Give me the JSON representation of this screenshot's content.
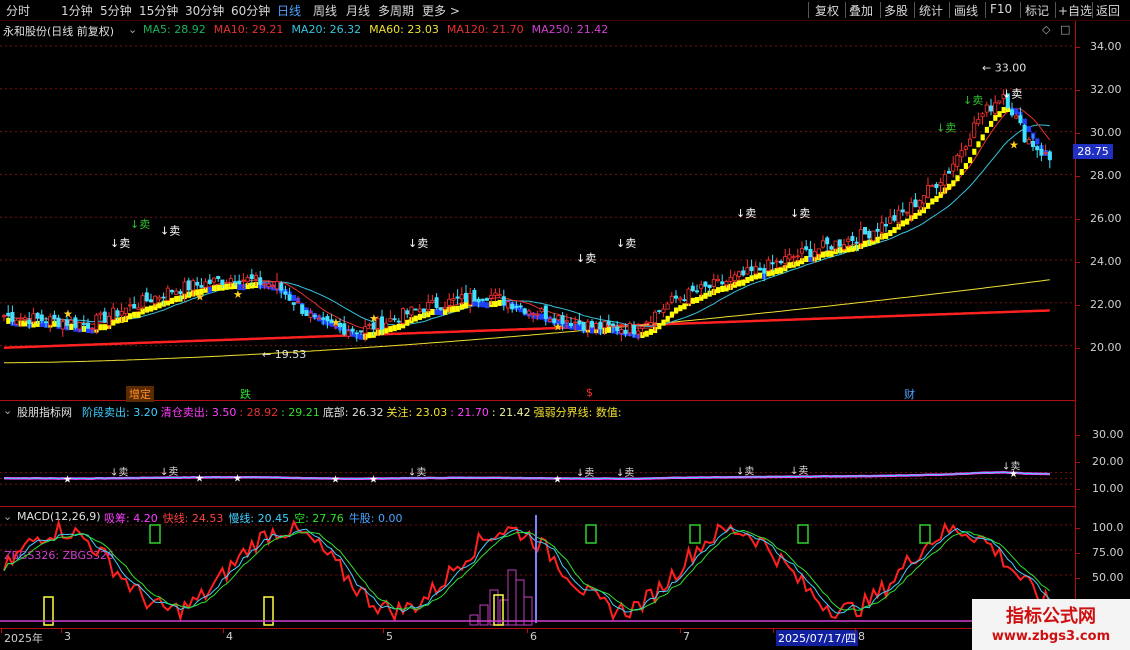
{
  "toolbar": {
    "left": [
      "分时",
      "1分钟",
      "5分钟",
      "15分钟",
      "30分钟",
      "60分钟",
      "日线",
      "周线",
      "月线",
      "多周期",
      "更多 >"
    ],
    "active": "日线",
    "right": [
      "复权",
      "叠加",
      "多股",
      "统计",
      "画线",
      "F10",
      "标记",
      "+自选",
      "返回"
    ]
  },
  "main_panel": {
    "stock_title": "永和股份(日线 前复权)",
    "ma": [
      {
        "label": "MA5: 28.92",
        "color": "#19b35a"
      },
      {
        "label": "MA10: 29.21",
        "color": "#e83030"
      },
      {
        "label": "MA20: 26.32",
        "color": "#36c4dc"
      },
      {
        "label": "MA60: 23.03",
        "color": "#f0e030"
      },
      {
        "label": "MA120: 21.70",
        "color": "#e83030"
      },
      {
        "label": "MA250: 21.42",
        "color": "#d040d0"
      }
    ],
    "y_ticks": [
      "34.00",
      "32.00",
      "30.00",
      "28.00",
      "26.00",
      "24.00",
      "22.00",
      "20.00"
    ],
    "price_tag": "28.75",
    "high_label": "33.00",
    "low_label": "19.53",
    "sell_label": "↓卖",
    "events": [
      {
        "label": "增定",
        "color": "#ff9030",
        "bg": "#5a2a00"
      },
      {
        "label": "跌",
        "color": "#30e030",
        "bg": ""
      },
      {
        "label": "$",
        "color": "#ff3030",
        "bg": ""
      },
      {
        "label": "财",
        "color": "#4aa3ff",
        "bg": ""
      }
    ]
  },
  "indicator_panel": {
    "title": "股朋指标网",
    "items": [
      {
        "text": "阶段卖出: 3.20",
        "color": "#40d0ff"
      },
      {
        "text": "清仓卖出: 3.50",
        "color": "#ff40ff"
      },
      {
        "text": ": 28.92",
        "color": "#e83030"
      },
      {
        "text": ": 29.21",
        "color": "#30e030"
      },
      {
        "text": "底部: 26.32",
        "color": "#e0e0e0"
      },
      {
        "text": "关注: 23.03",
        "color": "#f0e030"
      },
      {
        "text": ": 21.70",
        "color": "#ff40ff"
      },
      {
        "text": ": 21.42",
        "color": "#f0f0a0"
      },
      {
        "text": "强弱分界线: 数值:",
        "color": "#f0e030"
      }
    ],
    "y_ticks": [
      "30.00",
      "20.00",
      "10.00"
    ]
  },
  "macd_panel": {
    "title": "MACD(12,26,9)",
    "items": [
      {
        "text": "吸筹: 4.20",
        "color": "#ff40ff"
      },
      {
        "text": "快线: 24.53",
        "color": "#ff4040"
      },
      {
        "text": "慢线: 20.45",
        "color": "#40d0ff"
      },
      {
        "text": "空: 27.76",
        "color": "#30e030"
      },
      {
        "text": "牛股: 0.00",
        "color": "#4aa3ff"
      }
    ],
    "zbgs_label": "ZBGS326:  ZBGS326",
    "y_ticks": [
      "100.0",
      "75.00",
      "50.00"
    ]
  },
  "x_axis": [
    "2025年",
    "3",
    "4",
    "5",
    "6",
    "7",
    "2025/07/17/四",
    "8"
  ],
  "watermark": {
    "title": "指标公式网",
    "url": "www.zbgs3.com"
  },
  "colors": {
    "up": "#ff3030",
    "down": "#40e0ff",
    "grid": "#b01010",
    "yellow": "#ffff00",
    "blue": "#2040ff"
  }
}
